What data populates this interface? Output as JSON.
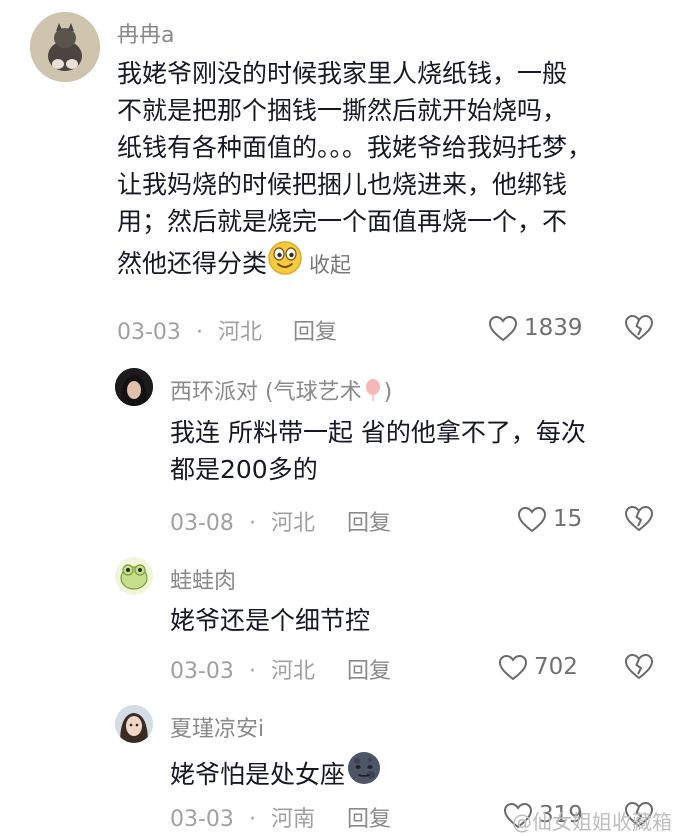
{
  "comments": [
    {
      "username": "冉冉a",
      "lines": [
        "我姥爷刚没的时候我家里人烧纸钱，一般",
        "不就是把那个捆钱一撕然后就开始烧吗，",
        "纸钱有各种面值的。。。我姥爷给我妈托梦，",
        "让我妈烧的时候把捆儿也烧进来，他绑钱",
        "用；然后就是烧完一个面值再烧一个，不",
        "然他还得分类"
      ],
      "emoji": "smiling-face-emoji",
      "collapse_label": "收起",
      "date": "03-03",
      "location": "河北",
      "reply_label": "回复",
      "likes": "1839"
    },
    {
      "username": "西环派对 (气球艺术",
      "username_suffix": ")",
      "username_icon": "balloon-icon",
      "lines": [
        "我连 所料带一起 省的他拿不了，每次",
        "都是200多的"
      ],
      "date": "03-08",
      "location": "河北",
      "reply_label": "回复",
      "likes": "15"
    },
    {
      "username": "蛙蛙肉",
      "lines": [
        "姥爷还是个细节控"
      ],
      "date": "03-03",
      "location": "河北",
      "reply_label": "回复",
      "likes": "702"
    },
    {
      "username": "夏瑾凉安i",
      "lines": [
        "姥爷怕是处女座"
      ],
      "emoji": "new-moon-face-emoji",
      "date": "03-03",
      "location": "河南",
      "reply_label": "回复",
      "likes": "319"
    }
  ],
  "separator": "·",
  "watermark": "@仙女姐姐收藏箱"
}
